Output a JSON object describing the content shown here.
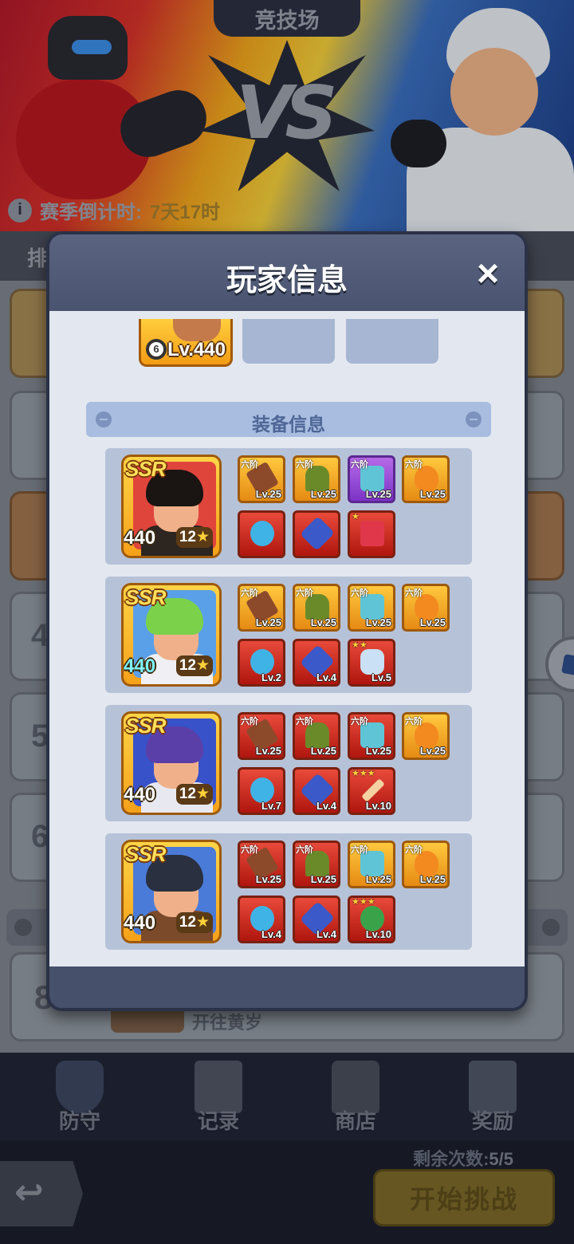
{
  "arena": {
    "title": "竞技场",
    "vs_text": "VS",
    "season_label": "赛季倒计时:",
    "season_value": "7天17时",
    "list_header_partial": "排",
    "row_numbers": [
      "4",
      "5",
      "6",
      "8"
    ],
    "bottom_row_text": "开往黄岁"
  },
  "nav": {
    "defense": "防守",
    "record": "记录",
    "shop": "商店",
    "reward": "奖励"
  },
  "footer": {
    "remaining_label": "剩余次数:",
    "remaining_value": "5/5",
    "start_label": "开始挑战"
  },
  "modal": {
    "title": "玩家信息",
    "close_icon": "×",
    "pet_level": "Lv.440",
    "section_title": "装备信息"
  },
  "heroes": [
    {
      "rarity": "SSR",
      "level": "440",
      "stars": "12",
      "level_color": "white",
      "equipment": [
        {
          "tier": "六阶",
          "lv": "Lv.25",
          "frame": "gold",
          "icon": "chainsaw-icon"
        },
        {
          "tier": "六阶",
          "lv": "Lv.25",
          "frame": "gold",
          "icon": "bush-icon"
        },
        {
          "tier": "六阶",
          "lv": "Lv.25",
          "frame": "purple",
          "icon": "gauntlet-icon"
        },
        {
          "tier": "六阶",
          "lv": "Lv.25",
          "frame": "gold",
          "icon": "mask-icon"
        },
        {
          "tier": "",
          "lv": "",
          "frame": "red",
          "icon": "horn-icon"
        },
        {
          "tier": "",
          "lv": "",
          "frame": "red",
          "icon": "badge-icon"
        },
        {
          "tier": "★",
          "lv": "",
          "frame": "red",
          "icon": "hammer-icon"
        }
      ]
    },
    {
      "rarity": "SSR",
      "level": "440",
      "stars": "12",
      "level_color": "cyan",
      "equipment": [
        {
          "tier": "六阶",
          "lv": "Lv.25",
          "frame": "gold",
          "icon": "chainsaw-icon"
        },
        {
          "tier": "六阶",
          "lv": "Lv.25",
          "frame": "gold",
          "icon": "bush-icon"
        },
        {
          "tier": "六阶",
          "lv": "Lv.25",
          "frame": "gold",
          "icon": "gauntlet-icon"
        },
        {
          "tier": "六阶",
          "lv": "Lv.25",
          "frame": "gold",
          "icon": "mask-icon"
        },
        {
          "tier": "",
          "lv": "Lv.2",
          "frame": "red",
          "icon": "horn-icon"
        },
        {
          "tier": "",
          "lv": "Lv.4",
          "frame": "red",
          "icon": "badge-icon"
        },
        {
          "tier": "★★",
          "lv": "Lv.5",
          "frame": "red",
          "icon": "bone-icon"
        }
      ]
    },
    {
      "rarity": "SSR",
      "level": "440",
      "stars": "12",
      "level_color": "white",
      "equipment": [
        {
          "tier": "六阶",
          "lv": "Lv.25",
          "frame": "red",
          "icon": "chainsaw-icon"
        },
        {
          "tier": "六阶",
          "lv": "Lv.25",
          "frame": "red",
          "icon": "bush-icon"
        },
        {
          "tier": "六阶",
          "lv": "Lv.25",
          "frame": "red",
          "icon": "gauntlet-icon"
        },
        {
          "tier": "六阶",
          "lv": "Lv.25",
          "frame": "gold",
          "icon": "mask-icon"
        },
        {
          "tier": "",
          "lv": "Lv.7",
          "frame": "red",
          "icon": "horn-icon"
        },
        {
          "tier": "",
          "lv": "Lv.4",
          "frame": "red",
          "icon": "badge-icon"
        },
        {
          "tier": "★★★",
          "lv": "Lv.10",
          "frame": "red",
          "icon": "sword-icon"
        }
      ]
    },
    {
      "rarity": "SSR",
      "level": "440",
      "stars": "12",
      "level_color": "white",
      "equipment": [
        {
          "tier": "六阶",
          "lv": "Lv.25",
          "frame": "red",
          "icon": "chainsaw-icon"
        },
        {
          "tier": "六阶",
          "lv": "Lv.25",
          "frame": "red",
          "icon": "bush-icon"
        },
        {
          "tier": "六阶",
          "lv": "Lv.25",
          "frame": "gold",
          "icon": "gauntlet-icon"
        },
        {
          "tier": "六阶",
          "lv": "Lv.25",
          "frame": "gold",
          "icon": "mask-icon"
        },
        {
          "tier": "",
          "lv": "Lv.4",
          "frame": "red",
          "icon": "horn-icon"
        },
        {
          "tier": "",
          "lv": "Lv.4",
          "frame": "red",
          "icon": "badge-icon"
        },
        {
          "tier": "★★★",
          "lv": "Lv.10",
          "frame": "red",
          "icon": "ball-icon"
        }
      ]
    }
  ]
}
